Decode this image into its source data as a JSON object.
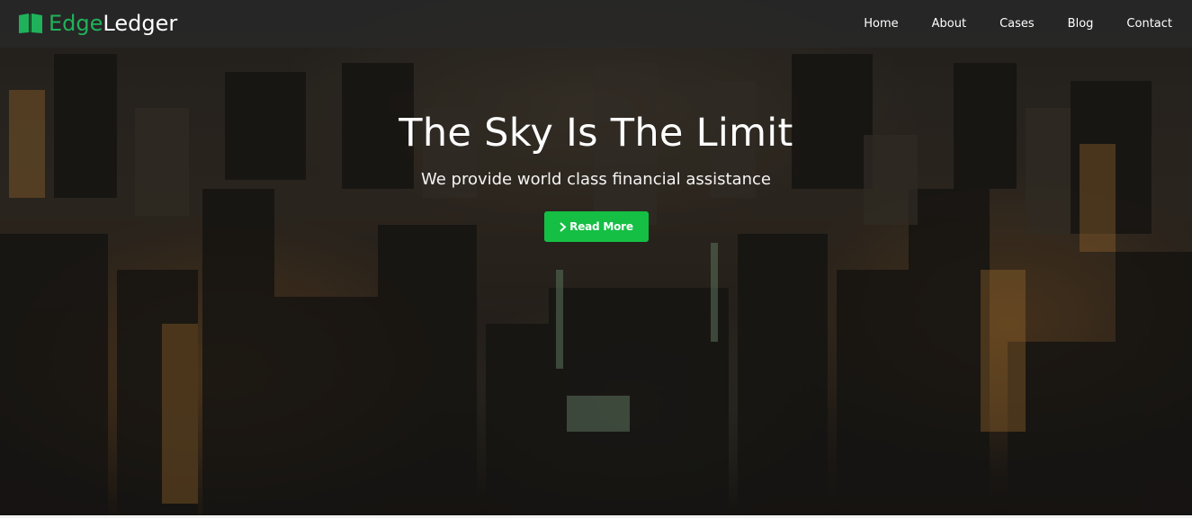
{
  "brand": {
    "name_part1": "Edge",
    "name_part2": "Ledger",
    "icon": "book-icon",
    "accent_color": "#1fb25a"
  },
  "nav": {
    "items": [
      {
        "label": "Home"
      },
      {
        "label": "About"
      },
      {
        "label": "Cases"
      },
      {
        "label": "Blog"
      },
      {
        "label": "Contact"
      }
    ]
  },
  "hero": {
    "title": "The Sky Is The Limit",
    "subtitle": "We provide world class financial assistance",
    "background": "night city skyline aerial photo",
    "cta": {
      "label": "Read More",
      "icon": "chevron-right-icon",
      "color": "#15bf44"
    }
  }
}
